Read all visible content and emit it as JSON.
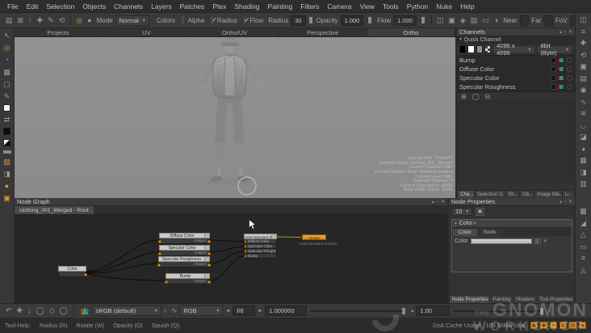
{
  "app": {
    "accent_color": "#e0922f",
    "viewport_bg": "#8e8e8e",
    "wire_color": "#0a0a0a"
  },
  "menu": {
    "items": [
      "File",
      "Edit",
      "Selection",
      "Objects",
      "Channels",
      "Layers",
      "Patches",
      "Ptex",
      "Shading",
      "Painting",
      "Filters",
      "Camera",
      "View",
      "Tools",
      "Python",
      "Nuke",
      "Help"
    ]
  },
  "icons": {
    "file": [
      "▤",
      "⊠",
      "↑",
      "✚",
      "✎",
      "⟲"
    ],
    "target": "◎",
    "dot": "●",
    "cam": [
      "◫",
      "▣",
      "◈",
      "▤",
      "▭",
      "◑"
    ],
    "tools": {
      "select": "↖",
      "transform": "◎",
      "ellipse": "◔",
      "patch": "▦",
      "marquee": "▢",
      "brush": "✎",
      "swap": "⇄",
      "paint_through": "▧",
      "clone": "◨",
      "blur": "●",
      "buffer": "▣"
    },
    "panel": [
      "▴",
      "▫",
      "✕"
    ],
    "chan_tools": [
      "⊞",
      "◯",
      "⊟"
    ],
    "right_strip": [
      "◫",
      "≡",
      "✚",
      "⟲",
      "▣",
      "▤",
      "◉",
      "∿",
      "≋",
      "◡",
      "◪",
      "◕",
      "▦",
      "◨",
      "▥"
    ],
    "right_strip_lower": [
      "▩",
      "◢",
      "△",
      "▭",
      "≡",
      "◬"
    ],
    "nav": [
      "↶",
      "✚",
      "↓",
      "◯",
      "◇",
      "◯"
    ],
    "lut": "∿",
    "step_left": "◄",
    "step_right": "►",
    "np_button": "▣",
    "status": [
      "▣",
      "◆",
      "●",
      "◧",
      "▤",
      "◉"
    ]
  },
  "toolbar": {
    "mode_label": "Mode",
    "mode_value": "Normal",
    "colors_label": "Colors",
    "alpha_label": "Alpha",
    "radius_check_label": "Radius",
    "flow_check_label": "Flow",
    "radius_label": "Radius",
    "radius_value": "30",
    "opacity_label": "Opacity",
    "opacity_value": "1.000",
    "flow_label": "Flow",
    "flow_value": "1.000",
    "near_label": "Near",
    "near_value": "",
    "far_label": "Far",
    "far_value": "",
    "fov_label": "FoV",
    "fov_value": ""
  },
  "view_tabs": {
    "items": [
      "Projects",
      "UV",
      "Ortho/UV",
      "Perspective",
      "Ortho"
    ]
  },
  "viewport_hud": {
    "lines": [
      "Current Tool : Paint (P)",
      "Current Object: clothing_001_Merged",
      "Current Channel Path:",
      "Current Shader: Artist Standard Surface",
      "Current Layer Path:",
      "Selected Patches: 0",
      "Current Colorspace: sRGB",
      "Paint Buffer Zoom: 200%"
    ]
  },
  "channels_panel": {
    "title": "Channels",
    "quick_channel_label": "Quick Channel",
    "size_value": "4096 x 4096",
    "depth_value": "8bit (Byte)",
    "rows": [
      "Bump",
      "Diffuse Color",
      "Specular Color",
      "Specular Roughness"
    ],
    "tabs": [
      "Cha...",
      "Selection G...",
      "Sh...",
      "Ob...",
      "Image Ma...",
      "Li..."
    ]
  },
  "node_graph": {
    "title": "Node Graph",
    "tab_label": "clothing_001_Merged - Root",
    "color_node": {
      "title": "Color"
    },
    "channel_nodes": [
      {
        "title": "Diffuse Color",
        "port": "Output"
      },
      {
        "title": "Specular Color",
        "port": "Output"
      },
      {
        "title": "Specular Roughness",
        "port": "Output"
      },
      {
        "title": "Bump",
        "port": "Output"
      }
    ],
    "shader_node": {
      "title": "Artist Standard Surface",
      "inputs": [
        "Diffuse Color",
        "Specular Color",
        "Specular Roughness",
        "Bump"
      ]
    },
    "viewer_node": {
      "title": "Viewer",
      "caption": "Artist Standard Surface"
    }
  },
  "node_properties": {
    "title": "Node Properties",
    "count_value": "10",
    "section_title": "Color",
    "tab_color": "Color",
    "tab_node": "Node",
    "color_field_label": "Color",
    "tabs": [
      "Node Properties",
      "Painting",
      "Shaders",
      "Tool Properties"
    ]
  },
  "bottom_bar": {
    "colorspace_value": "sRGB (default)",
    "display_value": "RGB",
    "fstop_value": "f/8",
    "gain_value": "1.000000",
    "zoom_value": "1.00"
  },
  "status_bar": {
    "tool_help_label": "Tool Help:",
    "shortcuts": [
      "Radius (R)",
      "Rotate (W)",
      "Opacity (O)",
      "Squish (Q)"
    ],
    "disk_cache_text": "Disk Cache Usage : 109.56MB (disk)"
  },
  "watermark": {
    "the": "THE",
    "line1": "GNOMON",
    "line2": "WORKSHOP"
  }
}
